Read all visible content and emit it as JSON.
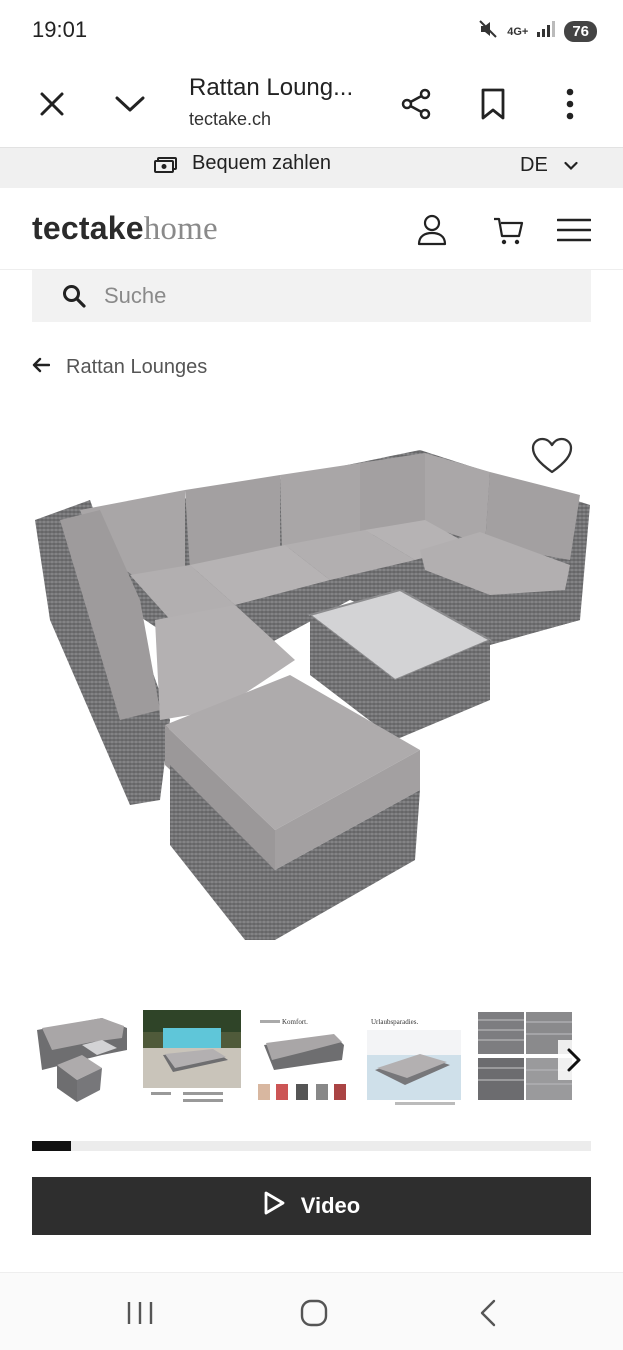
{
  "status": {
    "time": "19:01",
    "network": "4G+",
    "battery": "76"
  },
  "browser": {
    "title": "Rattan Loung...",
    "domain": "tectake.ch"
  },
  "promo": {
    "text": "Bequem zahlen",
    "language": "DE"
  },
  "header": {
    "logo_main": "tectake",
    "logo_sub": "home"
  },
  "search": {
    "placeholder": "Suche",
    "value": ""
  },
  "breadcrumb": {
    "label": "Rattan Lounges"
  },
  "thumbnails": {
    "labels": [
      "Komfort.",
      "Urlaubsparadies."
    ]
  },
  "gallery": {
    "progress": 0.07
  },
  "video_button": {
    "label": "Video"
  },
  "colors": {
    "accent": "#2e2e2e",
    "cushion": "#a9a6a7",
    "rattan": "#6f6f71"
  }
}
